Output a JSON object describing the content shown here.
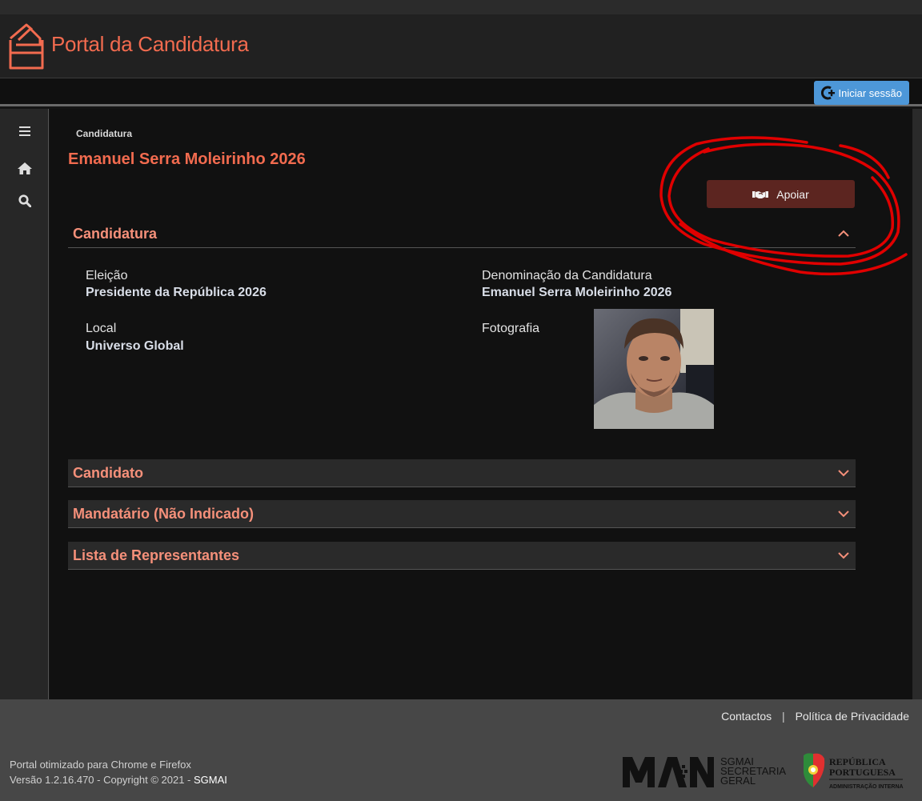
{
  "header": {
    "app_title": "Portal da Candidatura",
    "login_label": "Iniciar sessão"
  },
  "sidebar": {
    "items": [
      {
        "icon": "menu-icon"
      },
      {
        "icon": "home-icon"
      },
      {
        "icon": "search-icon"
      }
    ]
  },
  "main": {
    "breadcrumb": "Candidatura",
    "title": "Emanuel Serra Moleirinho 2026",
    "support_button": "Apoiar",
    "sections": [
      {
        "title": "Candidatura",
        "expanded": true
      },
      {
        "title": "Candidato",
        "expanded": false
      },
      {
        "title": "Mandatário (Não Indicado)",
        "expanded": false
      },
      {
        "title": "Lista de Representantes",
        "expanded": false
      }
    ],
    "fields": {
      "eleicao_label": "Eleição",
      "eleicao_value": "Presidente da República 2026",
      "denominacao_label": "Denominação da Candidatura",
      "denominacao_value": "Emanuel Serra Moleirinho 2026",
      "local_label": "Local",
      "local_value": "Universo Global",
      "fotografia_label": "Fotografia"
    }
  },
  "footer": {
    "contactos": "Contactos",
    "separator": "|",
    "privacidade": "Política de Privacidade",
    "optimized": "Portal otimizado para Chrome e Firefox",
    "version": "Versão 1.2.16.470 - Copyright © 2021 - ",
    "org": "SGMAI",
    "sgmai_logo_text": [
      "SGMAI",
      "SECRETARIA",
      "GERAL"
    ],
    "rp_logo_text": [
      "REPÚBLICA",
      "PORTUGUESA",
      "ADMINISTRAÇÃO INTERNA"
    ]
  },
  "colors": {
    "accent": "#f26b4f",
    "section_title": "#f5907a",
    "login_button": "#4d97d8",
    "support_button": "#5c2520",
    "annotation": "#e00000"
  }
}
